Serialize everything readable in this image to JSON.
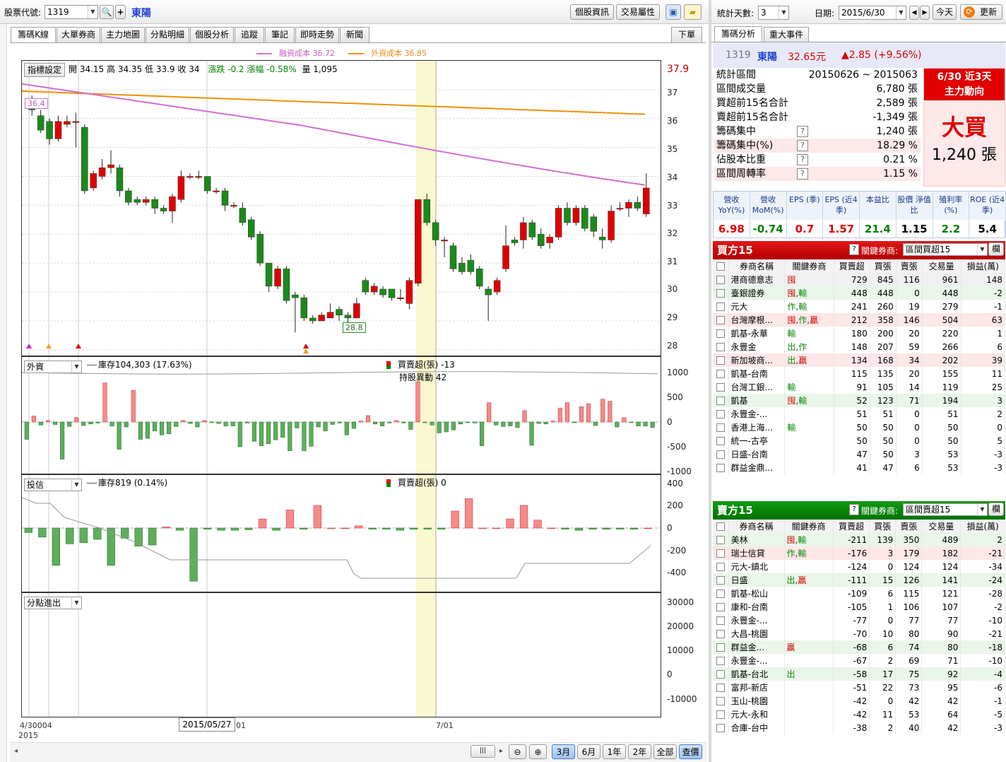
{
  "toolbar": {
    "stock_label": "股票代號:",
    "stock_code": "1319",
    "stock_name": "東陽",
    "btn_info": "個股資訊",
    "btn_attr": "交易屬性"
  },
  "tabs": [
    "籌碼K線",
    "大單券商",
    "主力地圖",
    "分點明細",
    "個股分析",
    "追蹤",
    "筆記",
    "即時走勢",
    "新聞"
  ],
  "tab_right": "下單",
  "legend": {
    "margin": "融資成本 36.72",
    "foreign": "外資成本 36.85"
  },
  "ohlc": {
    "btn": "指標設定",
    "open": "開 34.15",
    "high": "高 34.35",
    "low": "低 33.9",
    "close": "收 34",
    "chg": "漲跌 -0.2",
    "pct": "漲幅 -0.58%",
    "vol": "量 1,095",
    "last": "37.9"
  },
  "price_axis": [
    "37",
    "36",
    "35",
    "34",
    "33",
    "32",
    "31",
    "30",
    "29",
    "28"
  ],
  "price_marks": {
    "high": "36.4",
    "low": "28.8"
  },
  "foreign": {
    "select": "外資",
    "stock": "庫存104,303 (17.63%)",
    "net": "買賣超(張) -13",
    "change": "持股異動 42",
    "axis": [
      "1000",
      "500",
      "0",
      "-500",
      "-1000"
    ]
  },
  "trust": {
    "select": "投信",
    "stock": "庫存819 (0.14%)",
    "net": "買賣超(張) 0",
    "axis": [
      "400",
      "200",
      "0",
      "-200",
      "-400"
    ]
  },
  "branch": {
    "select": "分點進出",
    "axis": [
      "30000",
      "20000",
      "10000",
      "0",
      "-10000"
    ]
  },
  "xaxis": {
    "start": "4/30",
    "start2": "2015",
    "mid": "01",
    "end": "7/01",
    "tooltip": "2015/05/27",
    "extra": "004"
  },
  "bottom": {
    "b3m": "3月",
    "b6m": "6月",
    "b1y": "1年",
    "b2y": "2年",
    "ball": "全部",
    "bprice": "查價"
  },
  "right": {
    "days_label": "統計天數:",
    "days": "3",
    "date_label": "日期:",
    "date": "2015/6/30",
    "today": "今天",
    "refresh": "更新",
    "tabs": [
      "籌碼分析",
      "重大事件"
    ],
    "quote": {
      "code": "1319",
      "name": "東陽",
      "price": "32.65元",
      "chg": "▲2.85 (+9.56%)"
    },
    "stats": [
      {
        "k": "統計區間",
        "v": "20150626 ~ 2015063"
      },
      {
        "k": "區間成交量",
        "v": "6,780 張"
      },
      {
        "k": "買超前15名合計",
        "v": "2,589 張"
      },
      {
        "k": "賣超前15名合計",
        "v": "-1,349 張"
      },
      {
        "k": "籌碼集中",
        "v": "1,240 張",
        "q": "?"
      },
      {
        "k": "籌碼集中(%)",
        "v": "18.29 %",
        "q": "?"
      },
      {
        "k": "佔股本比重",
        "v": "0.21 %",
        "q": "?"
      },
      {
        "k": "區間周轉率",
        "v": "1.15 %",
        "q": "?"
      }
    ],
    "trend": {
      "title1": "6/30 近3天",
      "title2": "主力動向",
      "verdict": "大買",
      "amount": "1,240 張"
    },
    "metrics": [
      {
        "h": "營收 YoY(%)",
        "v": "6.98",
        "c": "#e00000"
      },
      {
        "h": "營收 MoM(%)",
        "v": "-0.74",
        "c": "#008000"
      },
      {
        "h": "EPS (季)",
        "v": "0.7",
        "c": "#e00000"
      },
      {
        "h": "EPS (近4季)",
        "v": "1.57",
        "c": "#e00000"
      },
      {
        "h": "本益比",
        "v": "21.4",
        "c": "#008000"
      },
      {
        "h": "股價 淨值比",
        "v": "1.15",
        "c": "#000"
      },
      {
        "h": "殖利率 (%)",
        "v": "2.2",
        "c": "#008000"
      },
      {
        "h": "ROE (近4季)",
        "v": "5.4",
        "c": "#000"
      }
    ],
    "buy": {
      "title": "買方15",
      "key_label": "關鍵券商:",
      "select": "區間買超15",
      "cols": [
        "券商名稱",
        "關鍵券商",
        "買賣超",
        "買張",
        "賣張",
        "交易量",
        "損益(萬)"
      ],
      "rows": [
        [
          "港商德意志",
          "囤",
          "729",
          "845",
          "116",
          "961",
          "148"
        ],
        [
          "臺銀證券",
          "囤,輸",
          "448",
          "448",
          "0",
          "448",
          "-2"
        ],
        [
          "元大",
          "作,輸",
          "241",
          "260",
          "19",
          "279",
          "-1"
        ],
        [
          "台灣摩根...",
          "囤,作,贏",
          "212",
          "358",
          "146",
          "504",
          "63"
        ],
        [
          "凱基-永華",
          "輸",
          "180",
          "200",
          "20",
          "220",
          "1"
        ],
        [
          "永豐金",
          "出,作",
          "148",
          "207",
          "59",
          "266",
          "6"
        ],
        [
          "新加坡商...",
          "出,贏",
          "134",
          "168",
          "34",
          "202",
          "39"
        ],
        [
          "凱基-台南",
          "",
          "115",
          "135",
          "20",
          "155",
          "11"
        ],
        [
          "台灣工銀...",
          "輸",
          "91",
          "105",
          "14",
          "119",
          "25"
        ],
        [
          "凱基",
          "囤,輸",
          "52",
          "123",
          "71",
          "194",
          "3"
        ],
        [
          "永豐金-...",
          "",
          "51",
          "51",
          "0",
          "51",
          "2"
        ],
        [
          "香港上海...",
          "輸",
          "50",
          "50",
          "0",
          "50",
          "0"
        ],
        [
          "統一-古亭",
          "",
          "50",
          "50",
          "0",
          "50",
          "5"
        ],
        [
          "日盛-台南",
          "",
          "47",
          "50",
          "3",
          "53",
          "-3"
        ],
        [
          "群益金鼎...",
          "",
          "41",
          "47",
          "6",
          "53",
          "-3"
        ]
      ]
    },
    "sell": {
      "title": "賣方15",
      "key_label": "關鍵券商:",
      "select": "區間賣超15",
      "cols": [
        "券商名稱",
        "關鍵券商",
        "買賣超",
        "買張",
        "賣張",
        "交易量",
        "損益(萬)"
      ],
      "rows": [
        [
          "美林",
          "囤,輸",
          "-211",
          "139",
          "350",
          "489",
          "2"
        ],
        [
          "瑞士信貸",
          "作,輸",
          "-176",
          "3",
          "179",
          "182",
          "-21"
        ],
        [
          "元大-鎮北",
          "",
          "-124",
          "0",
          "124",
          "124",
          "-34"
        ],
        [
          "日盛",
          "出,贏",
          "-111",
          "15",
          "126",
          "141",
          "-24"
        ],
        [
          "凱基-松山",
          "",
          "-109",
          "6",
          "115",
          "121",
          "-28"
        ],
        [
          "康和-台南",
          "",
          "-105",
          "1",
          "106",
          "107",
          "-2"
        ],
        [
          "永豐金-...",
          "",
          "-77",
          "0",
          "77",
          "77",
          "-10"
        ],
        [
          "大昌-桃園",
          "",
          "-70",
          "10",
          "80",
          "90",
          "-21"
        ],
        [
          "群益金...",
          "贏",
          "-68",
          "6",
          "74",
          "80",
          "-18"
        ],
        [
          "永豐金-...",
          "",
          "-67",
          "2",
          "69",
          "71",
          "-10"
        ],
        [
          "凱基-台北",
          "出",
          "-58",
          "17",
          "75",
          "92",
          "-4"
        ],
        [
          "富邦-新店",
          "",
          "-51",
          "22",
          "73",
          "95",
          "-6"
        ],
        [
          "玉山-桃園",
          "",
          "-42",
          "0",
          "42",
          "42",
          "-1"
        ],
        [
          "元大-永和",
          "",
          "-42",
          "11",
          "53",
          "64",
          "-5"
        ],
        [
          "合庫-台中",
          "",
          "-38",
          "2",
          "40",
          "42",
          "-3"
        ]
      ]
    }
  },
  "chart_data": {
    "type": "candlestick",
    "ylim": [
      27.8,
      38
    ],
    "candles": [
      [
        36.6,
        36.3,
        36.8,
        36.1
      ],
      [
        36.1,
        35.6,
        36.3,
        35.5
      ],
      [
        35.9,
        35.3,
        36.0,
        35.1
      ],
      [
        35.3,
        35.9,
        36.1,
        35.2
      ],
      [
        35.8,
        35.9,
        36.1,
        35.7
      ],
      [
        35.9,
        35.9,
        36.2,
        35.0
      ],
      [
        35.7,
        33.5,
        35.8,
        33.4
      ],
      [
        33.6,
        34.1,
        34.2,
        33.5
      ],
      [
        34.0,
        34.3,
        34.6,
        33.9
      ],
      [
        34.3,
        34.4,
        34.9,
        34.1
      ],
      [
        34.3,
        33.5,
        34.4,
        33.3
      ],
      [
        33.5,
        33.1,
        33.6,
        33.0
      ],
      [
        33.2,
        33.1,
        33.3,
        33.0
      ],
      [
        33.1,
        33.2,
        33.3,
        33.0
      ],
      [
        33.2,
        32.9,
        33.3,
        32.7
      ],
      [
        32.9,
        32.8,
        33.0,
        32.7
      ],
      [
        32.8,
        33.3,
        33.4,
        32.4
      ],
      [
        33.2,
        34.0,
        34.2,
        33.1
      ],
      [
        34.0,
        34.0,
        34.1,
        33.9
      ],
      [
        34.0,
        34.0,
        34.2,
        33.9
      ],
      [
        34.0,
        33.5,
        34.0,
        33.4
      ],
      [
        33.5,
        33.5,
        33.6,
        33.4
      ],
      [
        33.5,
        33.0,
        33.6,
        32.8
      ],
      [
        33.0,
        33.0,
        33.1,
        32.9
      ],
      [
        32.9,
        32.4,
        33.1,
        32.3
      ],
      [
        32.5,
        31.9,
        32.6,
        31.8
      ],
      [
        32.0,
        31.0,
        32.1,
        30.9
      ],
      [
        31.0,
        30.2,
        31.0,
        30.0
      ],
      [
        30.2,
        30.8,
        30.9,
        30.1
      ],
      [
        30.8,
        29.7,
        30.9,
        29.6
      ],
      [
        29.9,
        29.8,
        30.0,
        28.6
      ],
      [
        29.8,
        29.1,
        29.9,
        29.0
      ],
      [
        29.1,
        29.0,
        29.2,
        28.9
      ],
      [
        29.0,
        29.2,
        29.3,
        29.0
      ],
      [
        29.1,
        29.3,
        29.6,
        29.1
      ],
      [
        29.4,
        29.2,
        29.5,
        29.0
      ],
      [
        29.2,
        29.1,
        29.3,
        28.9
      ],
      [
        29.1,
        29.6,
        29.8,
        29.1
      ],
      [
        30.4,
        30.0,
        30.5,
        29.9
      ],
      [
        30.0,
        30.2,
        30.3,
        29.9
      ],
      [
        30.1,
        29.9,
        30.2,
        29.8
      ],
      [
        30.1,
        29.8,
        30.1,
        29.7
      ],
      [
        29.8,
        29.8,
        30.1,
        29.7
      ],
      [
        29.6,
        30.4,
        30.5,
        29.4
      ],
      [
        30.3,
        33.2,
        33.2,
        30.2
      ],
      [
        33.2,
        32.4,
        33.4,
        32.3
      ],
      [
        32.4,
        31.8,
        32.5,
        31.6
      ],
      [
        31.8,
        31.8,
        31.9,
        31.2
      ],
      [
        31.6,
        30.8,
        31.7,
        30.7
      ],
      [
        31.0,
        30.7,
        31.2,
        30.6
      ],
      [
        31.1,
        30.7,
        31.3,
        30.6
      ],
      [
        30.8,
        30.2,
        30.9,
        30.1
      ],
      [
        30.1,
        29.9,
        30.2,
        29.0
      ],
      [
        30.0,
        30.4,
        30.5,
        29.9
      ],
      [
        30.8,
        31.6,
        32.3,
        30.7
      ],
      [
        31.8,
        31.7,
        31.9,
        31.6
      ],
      [
        31.8,
        32.4,
        32.6,
        31.5
      ],
      [
        32.4,
        31.9,
        32.5,
        31.8
      ],
      [
        32.0,
        31.6,
        32.2,
        31.5
      ],
      [
        31.7,
        31.9,
        32.0,
        31.5
      ],
      [
        31.9,
        32.9,
        33.0,
        31.8
      ],
      [
        32.9,
        32.4,
        33.1,
        32.3
      ],
      [
        32.4,
        32.9,
        33.0,
        32.3
      ],
      [
        32.9,
        32.2,
        33.0,
        32.1
      ],
      [
        32.6,
        32.1,
        32.7,
        31.9
      ],
      [
        31.9,
        31.8,
        32.2,
        31.5
      ],
      [
        31.8,
        32.8,
        33.0,
        31.7
      ],
      [
        32.9,
        32.9,
        33.1,
        32.8
      ],
      [
        32.9,
        33.1,
        33.2,
        32.6
      ],
      [
        33.1,
        32.9,
        33.3,
        32.8
      ],
      [
        32.7,
        33.6,
        34.1,
        32.6
      ]
    ],
    "foreign": [
      -350,
      120,
      -60,
      30,
      -50,
      -750,
      -90,
      90,
      -70,
      -40,
      -20,
      790,
      -80,
      -550,
      -100,
      640,
      -350,
      -330,
      -180,
      -260,
      -240,
      -90,
      30,
      -30,
      -100,
      30,
      -10,
      -30,
      -80,
      -80,
      -500,
      -20,
      -390,
      -480,
      -440,
      -360,
      -310,
      -580,
      -120,
      -580,
      -490,
      -100,
      -180,
      -50,
      -20,
      -260,
      -130,
      20,
      130,
      -40,
      -80,
      -20,
      30,
      -20,
      -150,
      810,
      -10,
      -60,
      -220,
      -200,
      -160,
      -40,
      -10,
      -20,
      -480,
      390,
      -60,
      -90,
      -80,
      -110,
      230,
      -470,
      -30,
      -40,
      20,
      280,
      390,
      -10,
      310,
      370,
      -70,
      460,
      420,
      -100,
      90,
      -10,
      -80,
      -80,
      -110
    ],
    "trust": [
      -40,
      -80,
      -330,
      -140,
      -130,
      -100,
      -330,
      -90,
      -160,
      -150,
      10,
      -20,
      -470,
      -10,
      -20,
      -20,
      -15,
      80,
      -20,
      160,
      -10,
      200,
      0,
      0,
      20,
      -10,
      -10,
      -20,
      -10,
      -10,
      -10,
      150,
      260,
      0,
      0,
      80,
      200,
      70,
      0,
      -10,
      -20,
      -10,
      -10,
      -10,
      -10,
      0
    ],
    "x_labels": [
      "4/30",
      "01",
      "7/01"
    ]
  }
}
